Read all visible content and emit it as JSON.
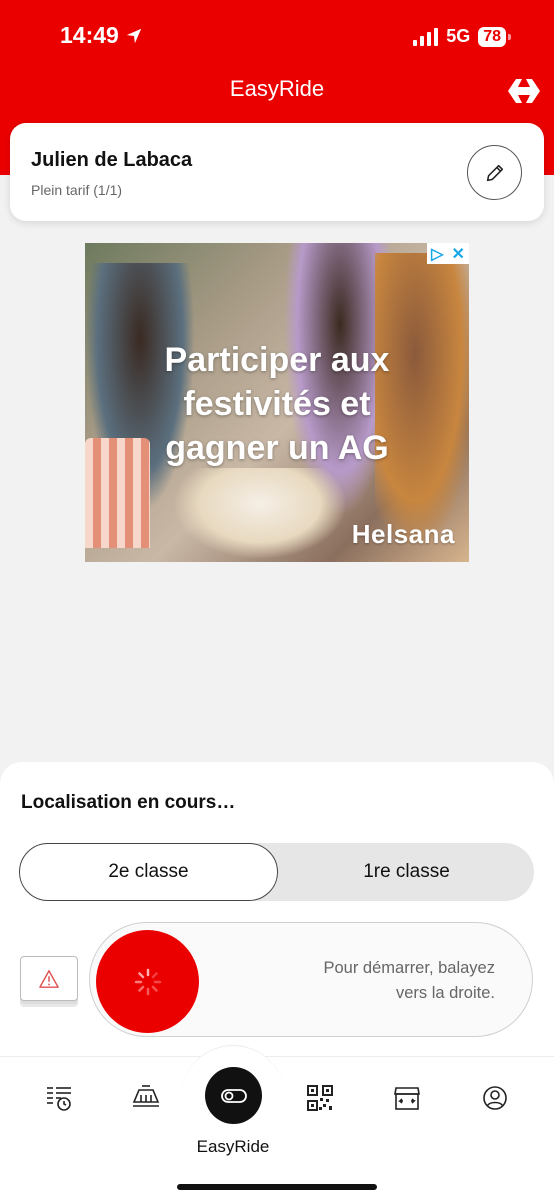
{
  "status_bar": {
    "time": "14:49",
    "network": "5G",
    "battery": "78"
  },
  "header": {
    "title": "EasyRide"
  },
  "profile": {
    "name": "Julien de Labaca",
    "tariff": "Plein tarif (1/1)"
  },
  "ad": {
    "headline_line1": "Participer aux",
    "headline_line2": "festivités et",
    "headline_line3": "gagner un AG",
    "brand": "Helsana"
  },
  "sheet": {
    "title": "Localisation en cours…",
    "class_options": [
      "2e classe",
      "1re classe"
    ],
    "selected_class": "2e classe",
    "swipe_hint_line1": "Pour démarrer, balayez",
    "swipe_hint_line2": "vers la droite."
  },
  "tabbar": {
    "center_label": "EasyRide",
    "items": [
      "timetable-icon",
      "train-icon",
      "easyride-icon",
      "qr-code-icon",
      "shop-icon",
      "profile-icon"
    ]
  },
  "colors": {
    "accent": "#eb0000"
  }
}
